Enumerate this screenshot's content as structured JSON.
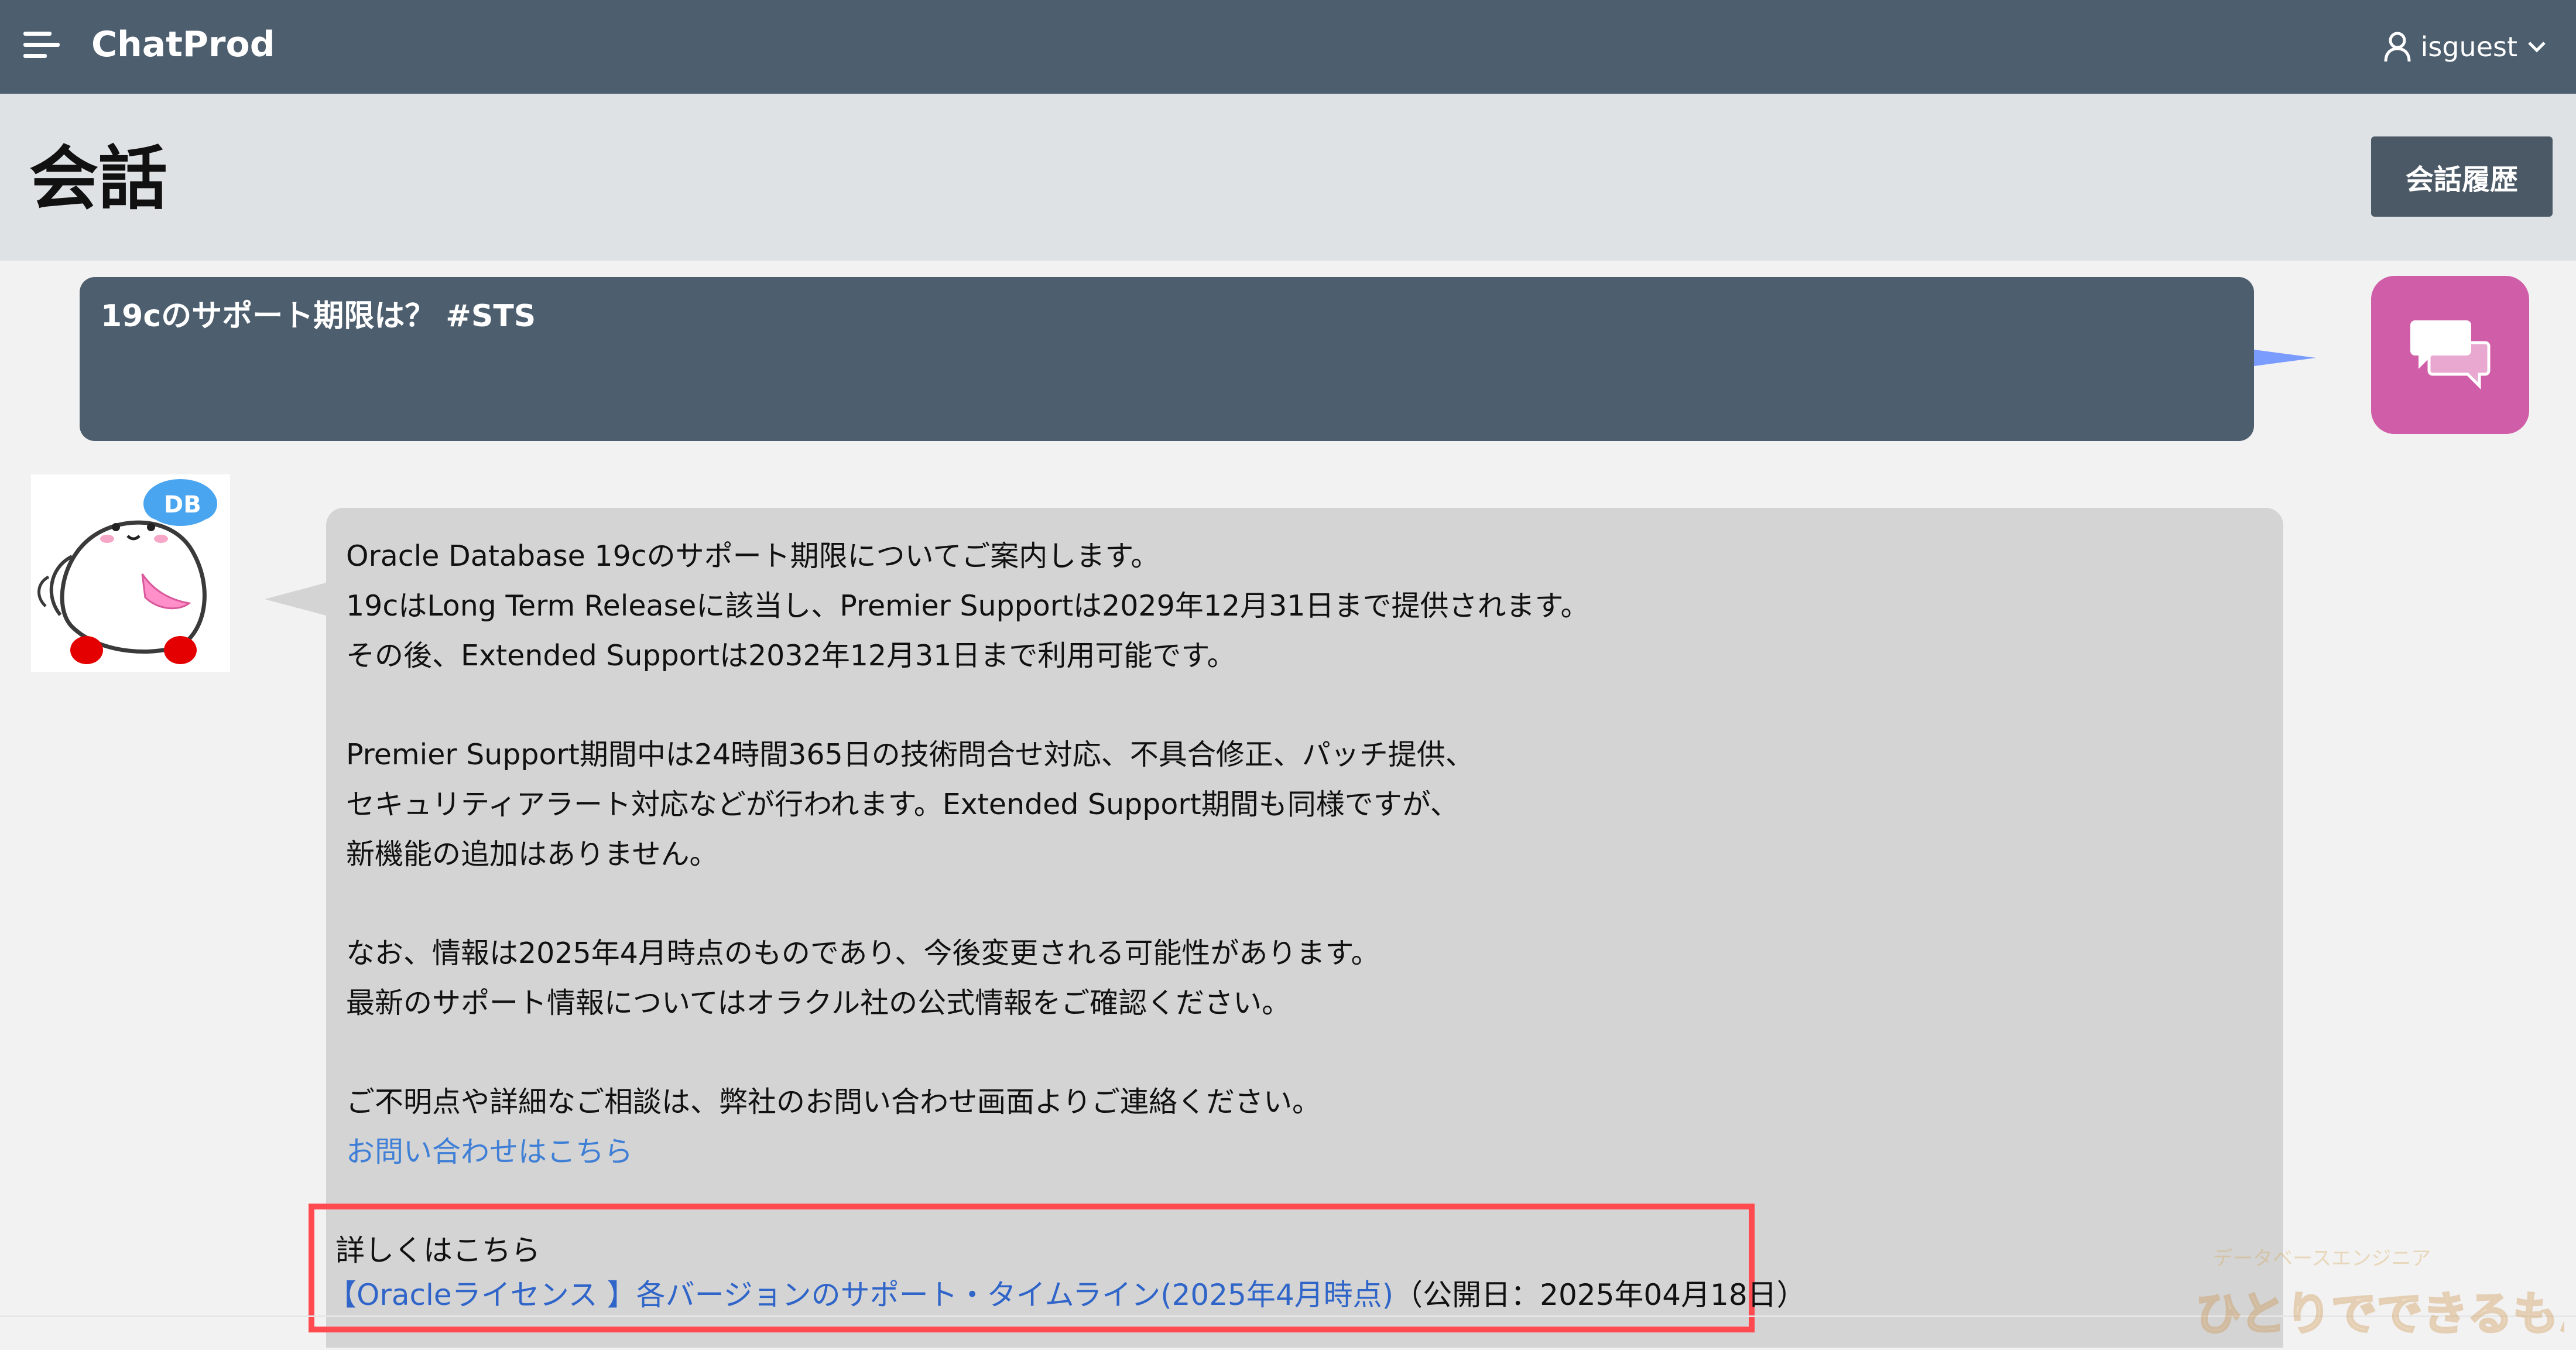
{
  "app": {
    "title": "ChatProd"
  },
  "user_menu": {
    "username": "isguest"
  },
  "page": {
    "title": "会話",
    "history_button": "会話履歴"
  },
  "user_message": {
    "text": "19cのサポート期限は？ #STS"
  },
  "bot_message": {
    "lines": [
      "Oracle Database 19cのサポート期限についてご案内します。",
      "19cはLong Term Releaseに該当し、Premier Supportは2029年12月31日まで提供されます。",
      "その後、Extended Supportは2032年12月31日まで利用可能です。",
      "Premier Support期間中は24時間365日の技術問合せ対応、不具合修正、パッチ提供、",
      "セキュリティアラート対応などが行われます。Extended Support期間も同様ですが、",
      "新機能の追加はありません。",
      "なお、情報は2025年4月時点のものであり、今後変更される可能性があります。",
      "最新のサポート情報についてはオラクル社の公式情報をご確認ください。",
      "ご不明点や詳細なご相談は、弊社のお問い合わせ画面よりご連絡ください。"
    ],
    "contact_link": "お問い合わせはこちら",
    "reference": {
      "heading": "詳しくはこちら",
      "link_text": "【Oracleライセンス 】各バージョンのサポート・タイムライン(2025年4月時点)",
      "published": "（公開日：2025年04月18日）"
    }
  },
  "bot_avatar": {
    "badge": "DB"
  },
  "watermark": {
    "caption": "データベースエンジニア",
    "title": "ひとりでできるもん"
  },
  "colors": {
    "topbar": "#4d5e6e",
    "header": "#dfe2e5",
    "user_bubble": "#4d5e6e",
    "bot_bubble": "#d4d4d4",
    "chat_avatar": "#d05da8",
    "link": "#3f7fd6",
    "highlight_border": "#ff4a4f"
  },
  "icons": {
    "menu": "hamburger-menu-icon",
    "user": "user-icon",
    "dropdown": "chevron-down-icon",
    "chat": "chat-bubbles-icon"
  }
}
